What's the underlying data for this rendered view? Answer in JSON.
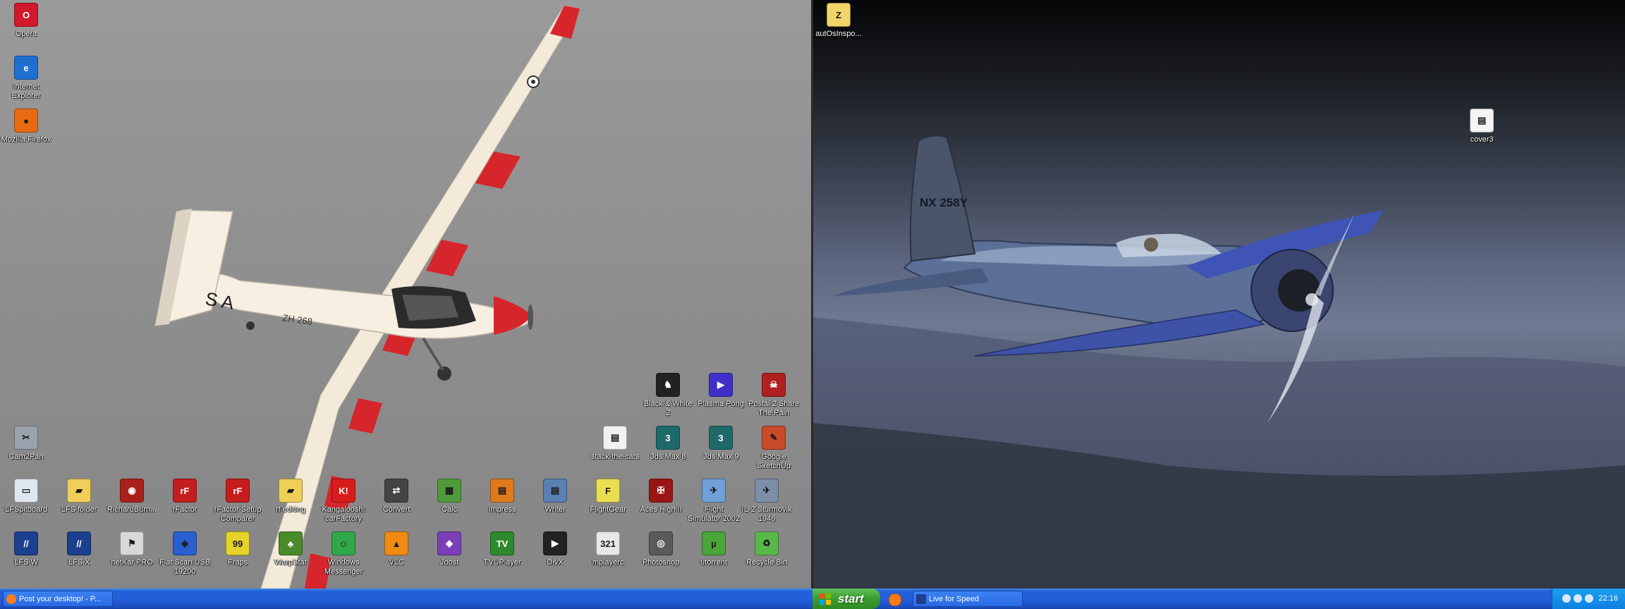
{
  "left_screen": {
    "icons": [
      {
        "label": "Opera",
        "glyph": "O",
        "color": "#d2182b"
      },
      {
        "label": "Internet Explorer",
        "glyph": "e",
        "color": "#1f6fd1"
      },
      {
        "label": "Mozilla Firefox",
        "glyph": "●",
        "color": "#e86b12"
      },
      {
        "label": "Cam2Pan",
        "glyph": "✂",
        "color": "#9aa3ad"
      },
      {
        "label": "LFSpitboard",
        "glyph": "▭",
        "color": "#dfe6f0"
      },
      {
        "label": "LFS folder",
        "glyph": "▰",
        "color": "#f0cf58"
      },
      {
        "label": "RichardBurn...",
        "glyph": "◉",
        "color": "#a8201c"
      },
      {
        "label": "rFactor",
        "glyph": "rF",
        "color": "#c51d1d"
      },
      {
        "label": "rFactor Setup Comparer",
        "glyph": "rF",
        "color": "#c51d1d"
      },
      {
        "label": "rf editing",
        "glyph": "▰",
        "color": "#f0cf58"
      },
      {
        "label": "Kangaloosh! carFactory",
        "glyph": "K!",
        "color": "#d71c1c"
      },
      {
        "label": "Convert",
        "glyph": "⇄",
        "color": "#444444"
      },
      {
        "label": "Calc",
        "glyph": "▦",
        "color": "#4f9a3a"
      },
      {
        "label": "Impress",
        "glyph": "▤",
        "color": "#e07b1c"
      },
      {
        "label": "Writer",
        "glyph": "▤",
        "color": "#5a7fb3"
      },
      {
        "label": "FlightGear",
        "glyph": "F",
        "color": "#e8e050"
      },
      {
        "label": "Aces High II",
        "glyph": "✠",
        "color": "#9a1515"
      },
      {
        "label": "Flight Simulator 2002",
        "glyph": "✈",
        "color": "#6fa0d8"
      },
      {
        "label": "IL-2 Sturmovik 1946",
        "glyph": "✈",
        "color": "#7d8ea8"
      },
      {
        "label": "LFS W",
        "glyph": "//",
        "color": "#1c3f8f"
      },
      {
        "label": "LFS X",
        "glyph": "//",
        "color": "#1c3f8f"
      },
      {
        "label": "netKar PRO",
        "glyph": "⚑",
        "color": "#d8d8d8"
      },
      {
        "label": "Flat Scan USB 19200",
        "glyph": "◈",
        "color": "#2a5fcf"
      },
      {
        "label": "Fraps",
        "glyph": "99",
        "color": "#e6d22a"
      },
      {
        "label": "WarpStat",
        "glyph": "♣",
        "color": "#4a8a2a"
      },
      {
        "label": "Windows Messenger",
        "glyph": "☺",
        "color": "#2fa84a"
      },
      {
        "label": "VLC",
        "glyph": "▲",
        "color": "#f08a10"
      },
      {
        "label": "Joost",
        "glyph": "◆",
        "color": "#7a3fb8"
      },
      {
        "label": "TVUPlayer",
        "glyph": "TV",
        "color": "#2c8a2c"
      },
      {
        "label": "DivX",
        "glyph": "▶",
        "color": "#222222"
      },
      {
        "label": "mplayerc",
        "glyph": "321",
        "color": "#e8e8e8"
      },
      {
        "label": "Photoshop",
        "glyph": "◎",
        "color": "#5a5a5a"
      },
      {
        "label": "utorrent",
        "glyph": "µ",
        "color": "#4aa53a"
      },
      {
        "label": "Recycle Bin",
        "glyph": "♻",
        "color": "#5ab84a"
      },
      {
        "label": "stack-the-cats",
        "glyph": "▤",
        "color": "#f2f2f2"
      },
      {
        "label": "3ds Max 8",
        "glyph": "3",
        "color": "#1e6a6a"
      },
      {
        "label": "3ds Max 9",
        "glyph": "3",
        "color": "#1e6a6a"
      },
      {
        "label": "Google SketchUp",
        "glyph": "✎",
        "color": "#c84a2a"
      },
      {
        "label": "Black & White 2",
        "glyph": "♞",
        "color": "#222222"
      },
      {
        "label": "Plasma Pong",
        "glyph": "▶",
        "color": "#4030c8"
      },
      {
        "label": "Postal 2 Share The Pain",
        "glyph": "☠",
        "color": "#b02020"
      }
    ]
  },
  "right_screen": {
    "icons": [
      {
        "label": "autOsInspo...",
        "glyph": "Z",
        "color": "#f2d56a"
      },
      {
        "label": "cover3",
        "glyph": "▤",
        "color": "#f4f4f4"
      }
    ],
    "plane_tail_text": "NX 258Y"
  },
  "left_taskbar": {
    "task_label": "Post your desktop! - P..."
  },
  "right_taskbar": {
    "start_label": "start",
    "task_label": "Live for Speed",
    "clock": "22:16"
  }
}
